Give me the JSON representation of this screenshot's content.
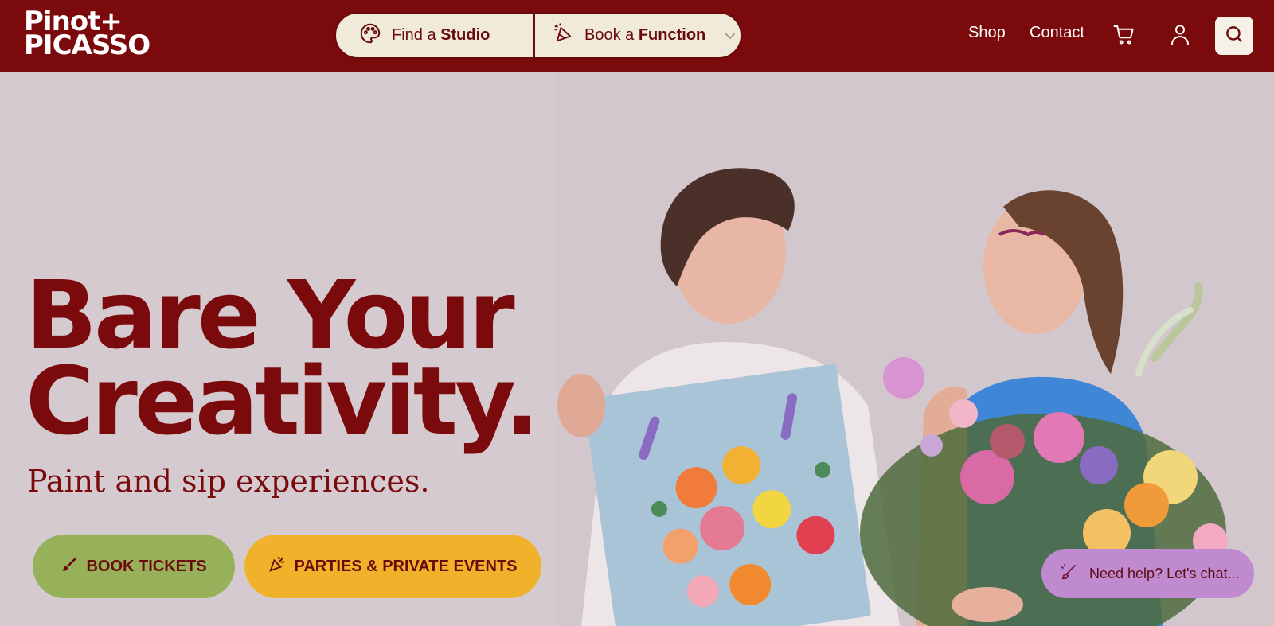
{
  "brand": {
    "logo_line1": "Pinot+",
    "logo_line2": "PICASSO"
  },
  "header": {
    "find_prefix": "Find a ",
    "find_bold": "Studio",
    "book_prefix": "Book a ",
    "book_bold": "Function",
    "nav_shop": "Shop",
    "nav_contact": "Contact",
    "icons": [
      "palette-icon",
      "party-hat-icon",
      "chevron-down-icon",
      "cart-icon",
      "user-icon",
      "search-icon"
    ]
  },
  "hero": {
    "title_line1": "Bare Your",
    "title_line2": "Creativity.",
    "subtitle": "Paint and sip experiences.",
    "cta_book": "BOOK TICKETS",
    "cta_parties": "PARTIES & PRIVATE EVENTS",
    "chat": "Need help? Let's chat..."
  },
  "colors": {
    "brand_red": "#7a0a0b",
    "cream": "#efeada",
    "green": "#97b05a",
    "yellow": "#f0b22a",
    "chat_purple": "#c08ad0"
  }
}
